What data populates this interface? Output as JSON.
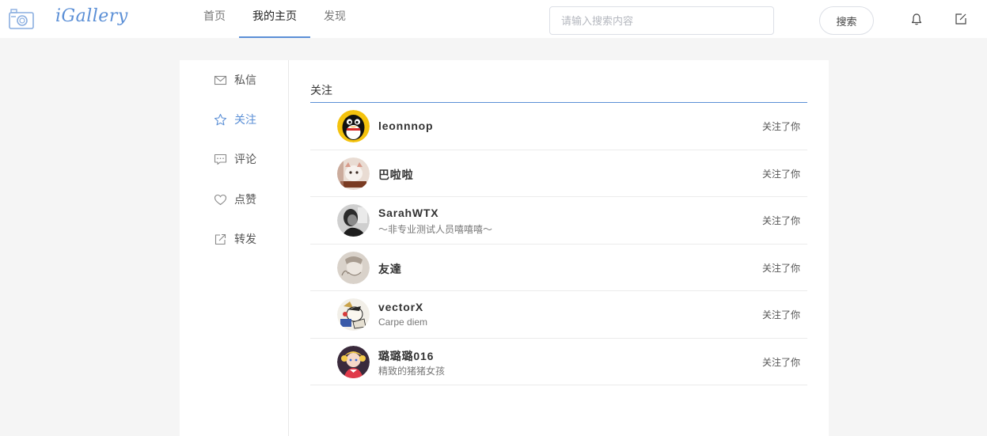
{
  "header": {
    "logo_text": "iGallery",
    "nav": [
      {
        "label": "首页"
      },
      {
        "label": "我的主页"
      },
      {
        "label": "发现"
      }
    ],
    "search_placeholder": "请输入搜索内容",
    "search_button": "搜索",
    "accent_color": "#5b8fd6"
  },
  "sidebar": {
    "items": [
      {
        "label": "私信",
        "icon": "mail-icon"
      },
      {
        "label": "关注",
        "icon": "star-icon"
      },
      {
        "label": "评论",
        "icon": "comment-icon"
      },
      {
        "label": "点赞",
        "icon": "heart-icon"
      },
      {
        "label": "转发",
        "icon": "share-icon"
      }
    ]
  },
  "content": {
    "section_title": "关注",
    "users": [
      {
        "name": "leonnnop",
        "bio": "",
        "status": "关注了你"
      },
      {
        "name": "巴啦啦",
        "bio": "",
        "status": "关注了你"
      },
      {
        "name": "SarahWTX",
        "bio": "～非专业测试人员嘻嘻嘻～",
        "status": "关注了你"
      },
      {
        "name": "友達",
        "bio": "",
        "status": "关注了你"
      },
      {
        "name": "vectorX",
        "bio": "Carpe diem",
        "status": "关注了你"
      },
      {
        "name": "璐璐璐016",
        "bio": "精致的猪猪女孩",
        "status": "关注了你"
      }
    ]
  }
}
